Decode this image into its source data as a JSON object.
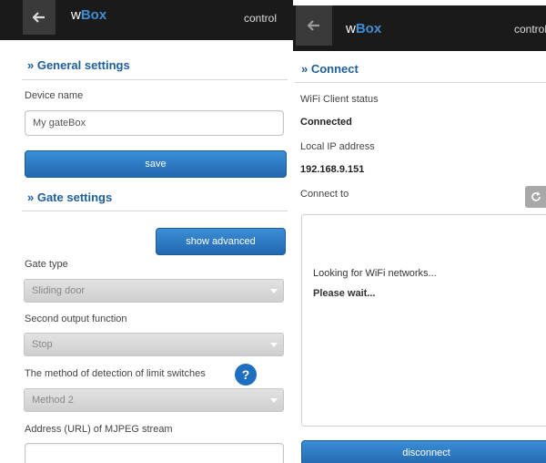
{
  "left": {
    "brand": {
      "prefix": "w",
      "bold": "Box"
    },
    "control_label": "control",
    "general_title": "» General settings",
    "device_name_label": "Device name",
    "device_name_value": "My gateBox",
    "save_label": "save",
    "gate_title": "» Gate settings",
    "show_advanced_label": "show advanced",
    "gate_type_label": "Gate type",
    "gate_type_value": "Sliding door",
    "second_output_label": "Second output function",
    "second_output_value": "Stop",
    "limit_method_label": "The method of detection of limit switches",
    "help_glyph": "?",
    "limit_method_value": "Method 2",
    "mjpeg_label": "Address (URL) of MJPEG stream",
    "mjpeg_value": ""
  },
  "right": {
    "brand": {
      "prefix": "w",
      "bold": "Box"
    },
    "control_label": "control",
    "connect_title": "» Connect",
    "wifi_status_label": "WiFi Client status",
    "wifi_status_value": "Connected",
    "local_ip_label": "Local IP address",
    "local_ip_value": "192.168.9.151",
    "connect_to_label": "Connect to",
    "looking_text": "Looking for WiFi networks...",
    "wait_text": "Please wait...",
    "disconnect_label": "disconnect"
  },
  "colors": {
    "accent_blue": "#2f7fc9",
    "title_blue": "#1d5e9c",
    "topbar": "#1a1a1a",
    "help_blue": "#1f6fc0"
  },
  "icons": [
    "back-arrow-icon",
    "chevron-down-icon",
    "help-icon",
    "refresh-icon"
  ]
}
